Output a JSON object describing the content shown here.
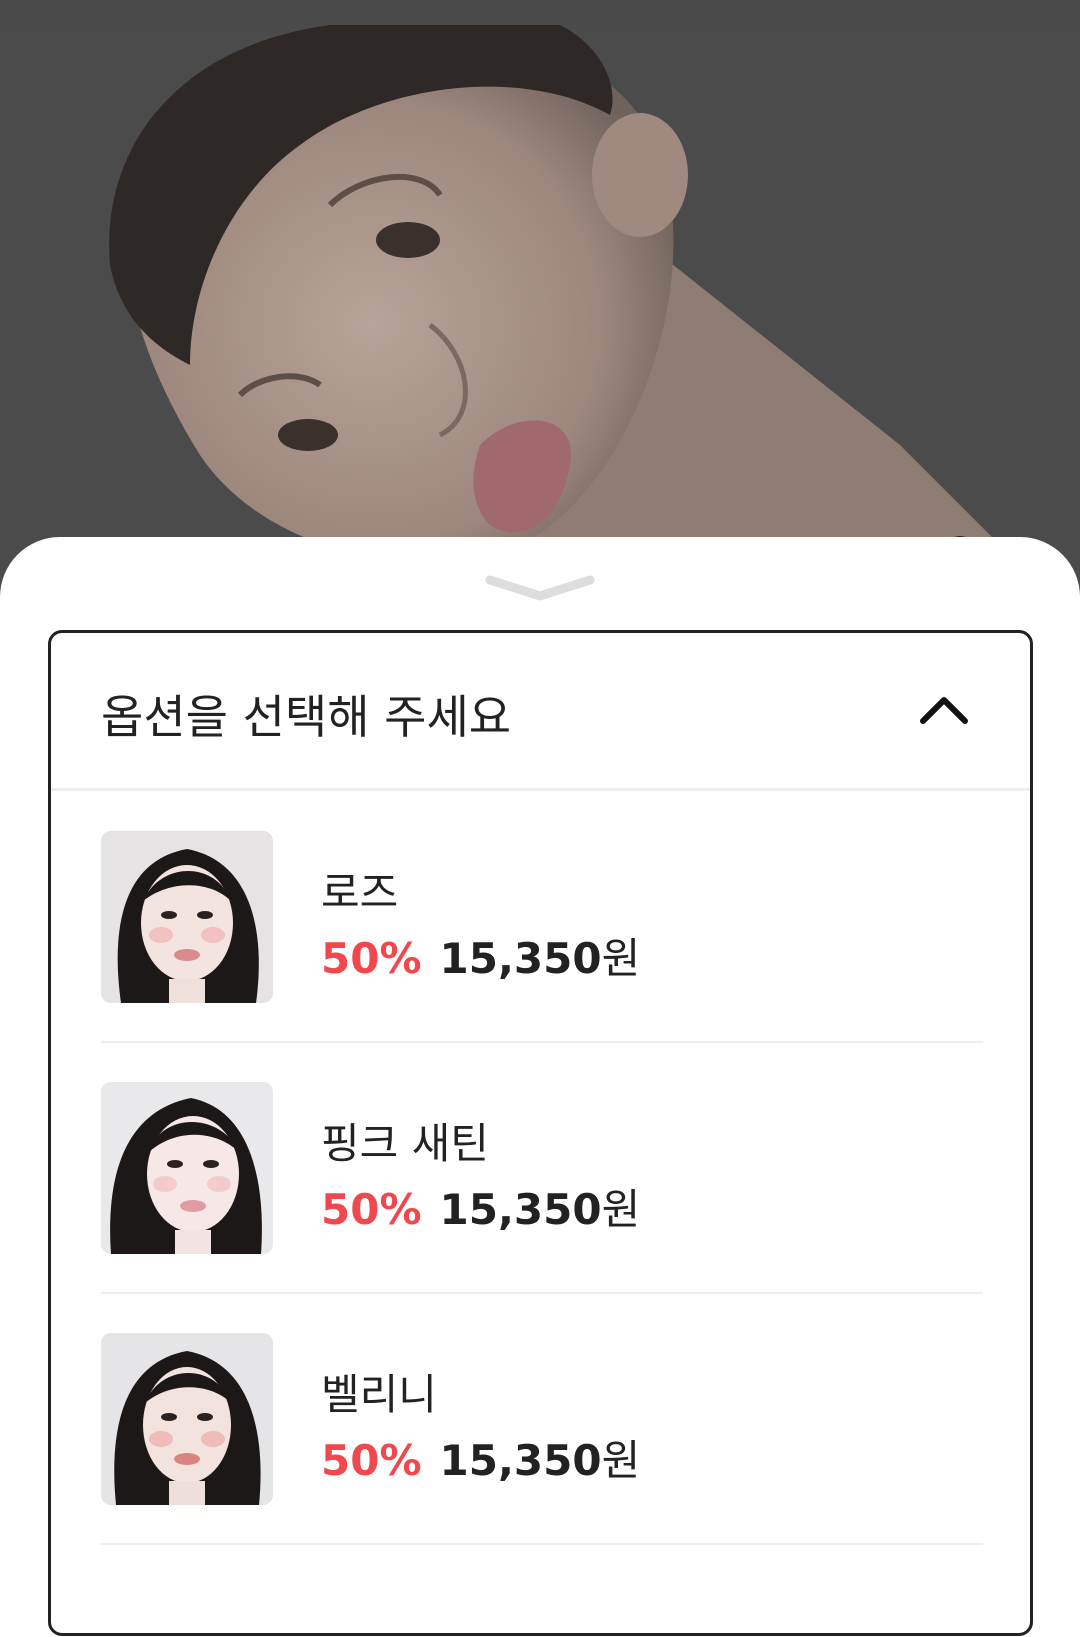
{
  "colors": {
    "overlay": "#4a4a4a",
    "discount": "#f0484f",
    "text": "#222222",
    "divider": "#eeeeee"
  },
  "option_select": {
    "placeholder": "옵션을 선택해 주세요",
    "expanded_icon": "chevron-up-icon"
  },
  "sheet_handle_icon": "chevron-down-icon",
  "options": [
    {
      "name": "로즈",
      "discount": "50%",
      "price": "15,350",
      "currency": "원"
    },
    {
      "name": "핑크 새틴",
      "discount": "50%",
      "price": "15,350",
      "currency": "원"
    },
    {
      "name": "벨리니",
      "discount": "50%",
      "price": "15,350",
      "currency": "원"
    }
  ]
}
